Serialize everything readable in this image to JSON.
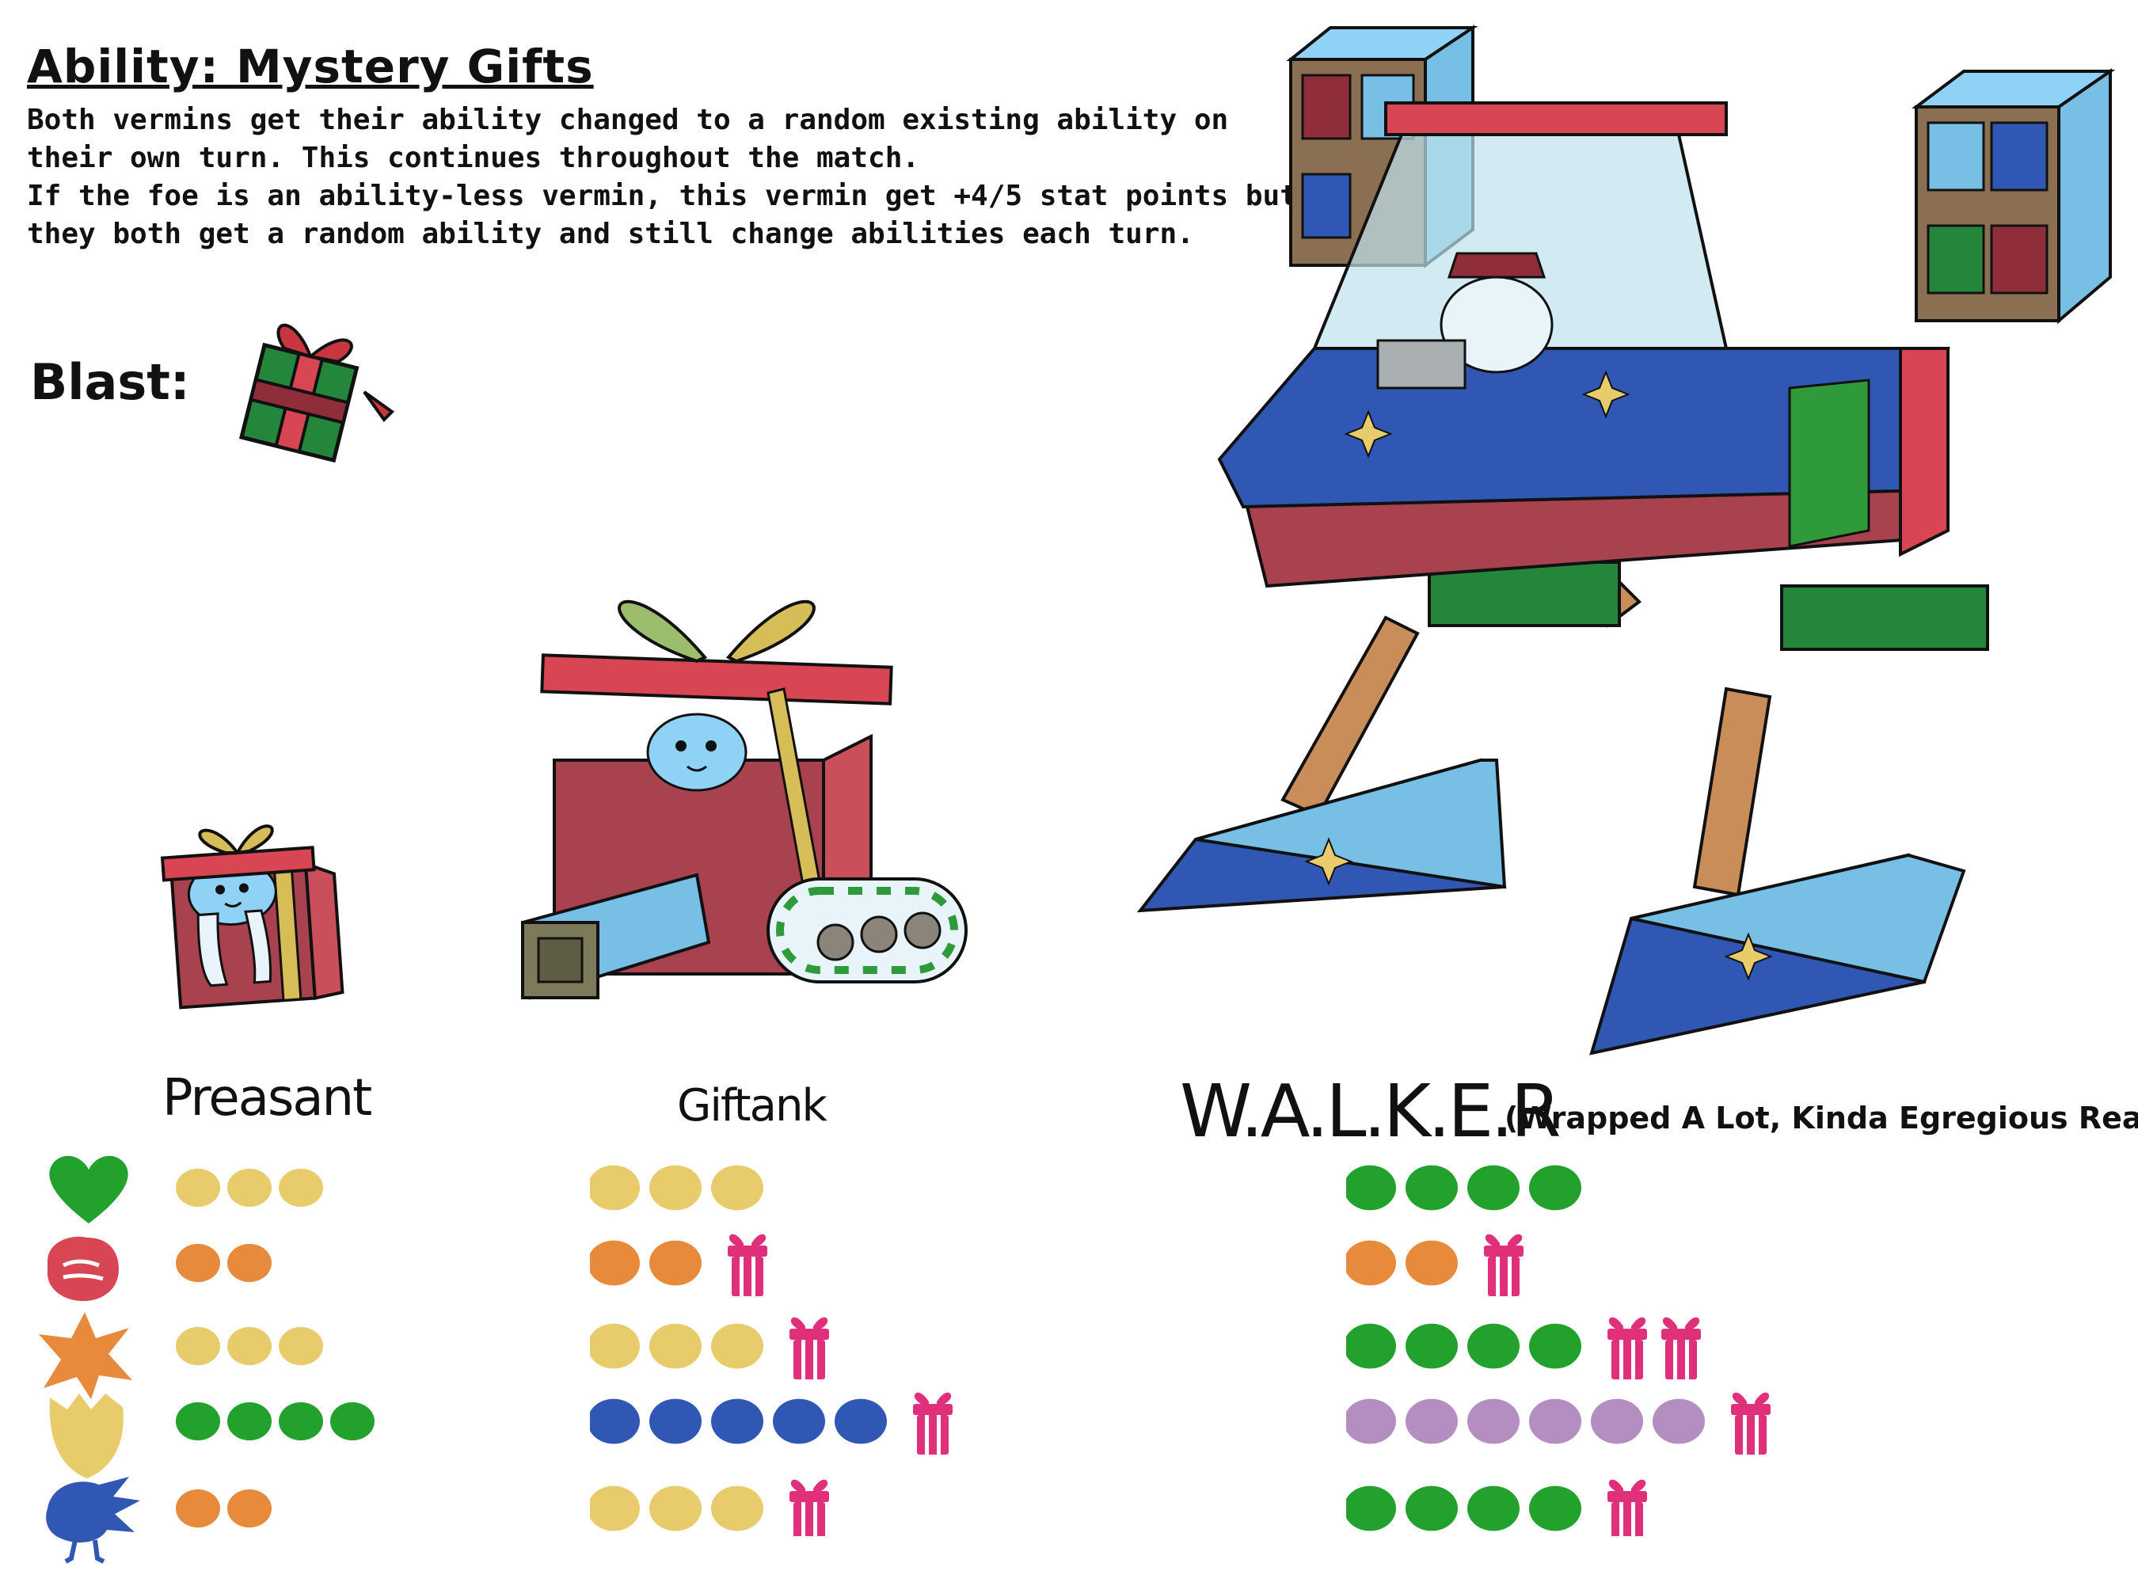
{
  "header": {
    "title": "Ability: Mystery Gifts",
    "description_lines": [
      "Both vermins get their ability changed to a random existing ability on",
      "their own turn. This continues throughout the match.",
      "If the foe is an ability-less vermin, this vermin get +4/5 stat points but",
      "they both get a random ability and still change abilities each turn."
    ]
  },
  "blast": {
    "label": "Blast:",
    "icon": "gift-box-icon"
  },
  "stat_icons": [
    "heart-icon",
    "fist-icon",
    "burst-icon",
    "shield-icon",
    "speed-icon"
  ],
  "forms": [
    {
      "name": "Preasant",
      "subtitle": "",
      "stats": [
        {
          "points": 3,
          "gifts": 0,
          "color": "#e8cc6c"
        },
        {
          "points": 2,
          "gifts": 0,
          "color": "#e88a3c"
        },
        {
          "points": 3,
          "gifts": 0,
          "color": "#e8cc6c"
        },
        {
          "points": 4,
          "gifts": 0,
          "color": "#23a12d"
        },
        {
          "points": 2,
          "gifts": 0,
          "color": "#e88a3c"
        }
      ]
    },
    {
      "name": "Giftank",
      "subtitle": "",
      "stats": [
        {
          "points": 3,
          "gifts": 0,
          "color": "#e8cc6c"
        },
        {
          "points": 2,
          "gifts": 1,
          "color": "#e88a3c"
        },
        {
          "points": 3,
          "gifts": 1,
          "color": "#e8cc6c"
        },
        {
          "points": 5,
          "gifts": 1,
          "color": "#2f57b3"
        },
        {
          "points": 3,
          "gifts": 1,
          "color": "#e8cc6c"
        }
      ]
    },
    {
      "name": "W.A.L.K.E.R",
      "subtitle": "(Wrapped A Lot, Kinda Egregious Really)",
      "stats": [
        {
          "points": 4,
          "gifts": 0,
          "color": "#23a12d"
        },
        {
          "points": 2,
          "gifts": 1,
          "color": "#e88a3c"
        },
        {
          "points": 4,
          "gifts": 2,
          "color": "#23a12d"
        },
        {
          "points": 6,
          "gifts": 1,
          "color": "#b48ec0"
        },
        {
          "points": 4,
          "gifts": 1,
          "color": "#23a12d"
        }
      ]
    }
  ],
  "colors": {
    "gift_pink": "#e0307c",
    "box_red": "#a8424f",
    "lid_red": "#d74652",
    "ribbon_yellow": "#d7bd58",
    "wrap_blue": "#2f57b3",
    "wrap_light_blue": "#78bfe6",
    "leg_tan": "#c98d5a",
    "foot_green": "#23863a",
    "creature_blue": "#8fd2f5"
  }
}
